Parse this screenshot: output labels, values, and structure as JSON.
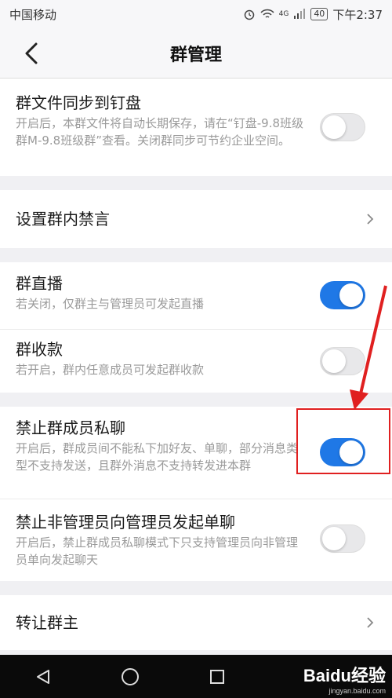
{
  "status_bar": {
    "carrier": "中国移动",
    "network": "4G",
    "battery": "40",
    "time": "下午2:37"
  },
  "nav": {
    "title": "群管理"
  },
  "sync_file": {
    "title": "群文件同步到钉盘",
    "desc": "开启后，本群文件将自动长期保存，请在“钉盘-9.8班级群M-9.8班级群”查看。关闭群同步可节约企业空间。",
    "enabled": false
  },
  "mute": {
    "title": "设置群内禁言"
  },
  "live": {
    "title": "群直播",
    "desc": "若关闭，仅群主与管理员可发起直播",
    "enabled": true
  },
  "collect": {
    "title": "群收款",
    "desc": "若开启，群内任意成员可发起群收款",
    "enabled": false
  },
  "private_chat": {
    "title": "禁止群成员私聊",
    "desc": "开启后，群成员间不能私下加好友、单聊，部分消息类型不支持发送，且群外消息不支持转发进本群",
    "enabled": true
  },
  "admin_chat": {
    "title": "禁止非管理员向管理员发起单聊",
    "desc": "开启后，禁止群成员私聊模式下只支持管理员向非管理员单向发起聊天",
    "enabled": false
  },
  "transfer": {
    "title": "转让群主"
  },
  "watermark": {
    "logo": "Baidu经验",
    "url": "jingyan.baidu.com"
  },
  "colors": {
    "toggle_on": "#1f78e6",
    "annotation": "#e02020"
  }
}
